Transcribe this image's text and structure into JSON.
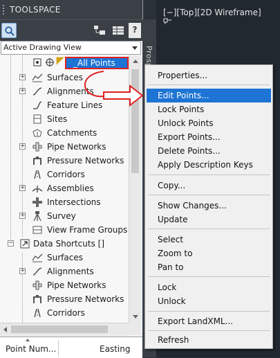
{
  "toolspace": {
    "title": "TOOLSPACE",
    "help_label": "?",
    "view_selector": "Active Drawing View"
  },
  "side_tab": {
    "label": "Prospector"
  },
  "viewport": {
    "label": "[−][Top][2D Wireframe]"
  },
  "tree": {
    "selected": "_All Points",
    "items": [
      "Surfaces",
      "Alignments",
      "Feature Lines",
      "Sites",
      "Catchments",
      "Pipe Networks",
      "Pressure Networks",
      "Corridors",
      "Assemblies",
      "Intersections",
      "Survey",
      "View Frame Groups"
    ],
    "data_shortcuts": "Data Shortcuts []",
    "shortcut_items": [
      "Surfaces",
      "Alignments",
      "Pipe Networks",
      "Pressure Networks",
      "Corridors"
    ]
  },
  "columns": {
    "col1": "Point Num...",
    "col2": "Easting"
  },
  "context_menu": {
    "properties": "Properties...",
    "edit_points": "Edit Points...",
    "lock_points": "Lock Points",
    "unlock_points": "Unlock Points",
    "export_points": "Export Points...",
    "delete_points": "Delete Points...",
    "apply_description_keys": "Apply Description Keys",
    "copy": "Copy...",
    "show_changes": "Show Changes...",
    "update": "Update",
    "select": "Select",
    "zoom_to": "Zoom to",
    "pan_to": "Pan to",
    "lock": "Lock",
    "unlock": "Unlock",
    "export_landxml": "Export LandXML...",
    "refresh": "Refresh"
  },
  "colors": {
    "highlight": "#1d74d4",
    "annotation": "#e02020"
  }
}
